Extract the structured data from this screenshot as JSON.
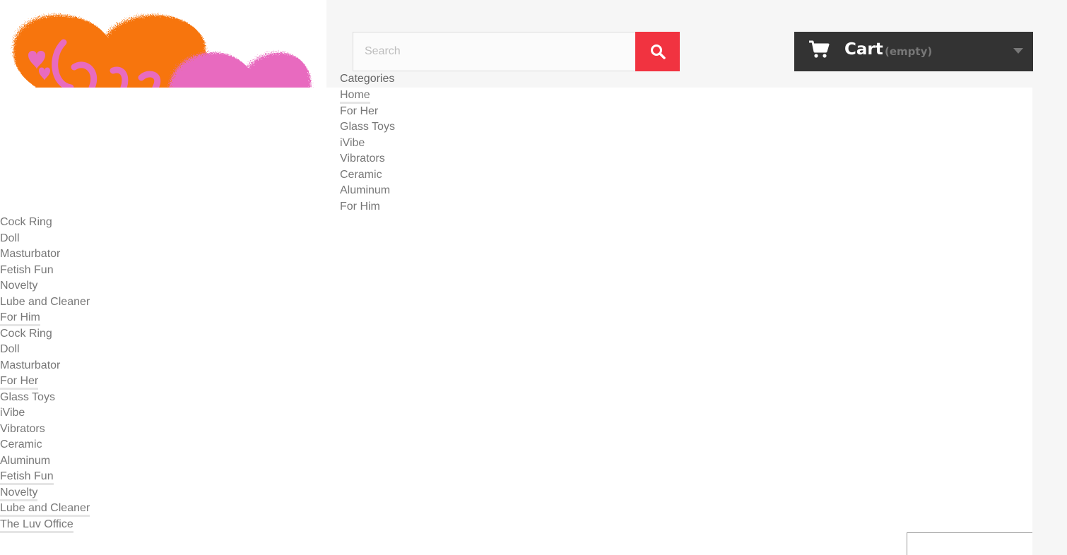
{
  "logo": {
    "alt_text": "Lotsa",
    "colors": {
      "orange": "#f7750e",
      "pink": "#e86bbf"
    }
  },
  "search": {
    "placeholder": "Search",
    "button_icon": "search-icon",
    "button_color": "#f13340"
  },
  "cart": {
    "icon": "shopping-cart-icon",
    "label": "Cart",
    "quantity_text": "(empty)",
    "dropdown_icon": "chevron-down-icon",
    "background": "#333333"
  },
  "menu": {
    "title": "Categories",
    "items": [
      {
        "label": "Home",
        "underline": true
      },
      {
        "label": "For Her",
        "underline": false
      },
      {
        "label": "Glass Toys",
        "underline": false
      },
      {
        "label": "iVibe",
        "underline": false
      },
      {
        "label": "Vibrators",
        "underline": false
      },
      {
        "label": "Ceramic",
        "underline": false
      },
      {
        "label": "Aluminum",
        "underline": false
      },
      {
        "label": "For Him",
        "underline": false
      }
    ]
  },
  "submenu": {
    "items": [
      {
        "label": "Cock Ring",
        "underline": false
      },
      {
        "label": "Doll",
        "underline": false
      },
      {
        "label": "Masturbator",
        "underline": false
      },
      {
        "label": "Fetish Fun",
        "underline": false
      },
      {
        "label": "Novelty",
        "underline": false
      },
      {
        "label": "Lube and Cleaner",
        "underline": false
      },
      {
        "label": "For Him",
        "underline": true
      },
      {
        "label": "Cock Ring",
        "underline": false
      },
      {
        "label": "Doll",
        "underline": false
      },
      {
        "label": "Masturbator",
        "underline": false
      },
      {
        "label": "For Her",
        "underline": true
      },
      {
        "label": "Glass Toys",
        "underline": false
      },
      {
        "label": "iVibe",
        "underline": false
      },
      {
        "label": "Vibrators",
        "underline": false
      },
      {
        "label": "Ceramic",
        "underline": false
      },
      {
        "label": "Aluminum",
        "underline": false
      },
      {
        "label": "Fetish Fun",
        "underline": true
      },
      {
        "label": "Novelty",
        "underline": true
      },
      {
        "label": "Lube and Cleaner",
        "underline": true
      },
      {
        "label": "The Luv Office",
        "underline": true
      }
    ]
  }
}
